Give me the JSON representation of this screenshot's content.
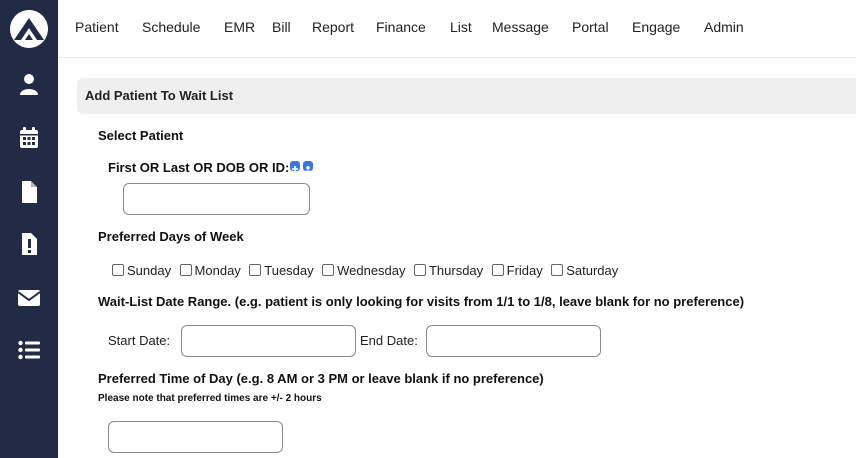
{
  "nav": {
    "items": [
      {
        "label": "Patient"
      },
      {
        "label": "Schedule"
      },
      {
        "label": "EMR"
      },
      {
        "label": "Bill"
      },
      {
        "label": "Report"
      },
      {
        "label": "Finance"
      },
      {
        "label": "List"
      },
      {
        "label": "Message"
      },
      {
        "label": "Portal"
      },
      {
        "label": "Engage"
      },
      {
        "label": "Admin"
      }
    ]
  },
  "sidebar": {
    "icons": [
      "patient-icon",
      "calendar-icon",
      "document-icon",
      "alert-document-icon",
      "mail-icon",
      "list-icon"
    ]
  },
  "colors": {
    "sidebar_bg": "#212b45",
    "accent_blue": "#3a79d8",
    "section_bg": "#efefef"
  },
  "form": {
    "section_title": "Add Patient To Wait List",
    "select_patient_label": "Select Patient",
    "search_label": "First OR Last OR DOB OR ID:",
    "search_value": "",
    "preferred_days_label": "Preferred Days of Week",
    "days": [
      "Sunday",
      "Monday",
      "Tuesday",
      "Wednesday",
      "Thursday",
      "Friday",
      "Saturday"
    ],
    "date_range_label": "Wait-List Date Range. (e.g. patient is only looking for visits from 1/1 to 1/8, leave blank for no preference)",
    "start_date_label": "Start Date:",
    "start_date_value": "",
    "end_date_label": "End Date:",
    "end_date_value": "",
    "time_label": "Preferred Time of Day (e.g. 8 AM or 3 PM or leave blank if no preference)",
    "time_note": "Please note that preferred times are +/- 2 hours",
    "time_value": ""
  }
}
